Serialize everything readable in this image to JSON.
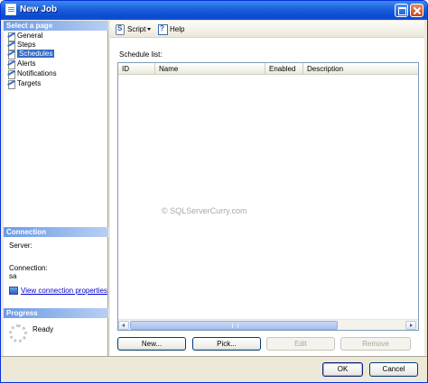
{
  "window": {
    "title": "New Job"
  },
  "left": {
    "select_page_header": "Select a page",
    "pages": [
      {
        "label": "General",
        "selected": false
      },
      {
        "label": "Steps",
        "selected": false
      },
      {
        "label": "Schedules",
        "selected": true
      },
      {
        "label": "Alerts",
        "selected": false
      },
      {
        "label": "Notifications",
        "selected": false
      },
      {
        "label": "Targets",
        "selected": false
      }
    ],
    "connection": {
      "header": "Connection",
      "server_label": "Server:",
      "connection_label": "Connection:",
      "connection_value": "sa",
      "link": "View connection properties"
    },
    "progress": {
      "header": "Progress",
      "status": "Ready"
    }
  },
  "toolbar": {
    "script_label": "Script",
    "help_label": "Help"
  },
  "schedules": {
    "list_label": "Schedule list:",
    "columns": [
      "ID",
      "Name",
      "Enabled",
      "Description"
    ],
    "rows": []
  },
  "watermark": "© SQLServerCurry.com",
  "buttons": {
    "new": "New...",
    "pick": "Pick...",
    "edit": "Edit",
    "remove": "Remove"
  },
  "footer": {
    "ok": "OK",
    "cancel": "Cancel"
  }
}
